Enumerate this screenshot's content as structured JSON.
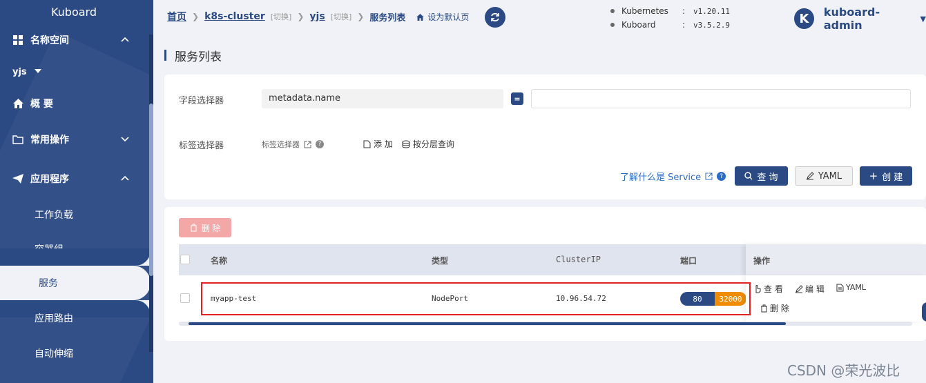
{
  "sidebar": {
    "brand": "Kuboard",
    "namespace_label": "名称空间",
    "namespace_value": "yjs",
    "overview": "概 要",
    "common_ops": "常用操作",
    "applications": "应用程序",
    "sub_items": [
      "工作负载",
      "容器组",
      "服务",
      "应用路由",
      "自动伸缩"
    ]
  },
  "header": {
    "home": "首页",
    "cluster": "k8s-cluster",
    "cluster_switch": "[切换]",
    "namespace": "yjs",
    "namespace_switch": "[切换]",
    "current": "服务列表",
    "set_default": "设为默认页",
    "versions": [
      {
        "name": "Kubernetes",
        "value": "v1.20.11"
      },
      {
        "name": "Kuboard",
        "value": "v3.5.2.9"
      }
    ],
    "user_initial": "K",
    "user_name": "kuboard-admin"
  },
  "page_title": "服务列表",
  "filter": {
    "field_selector_label": "字段选择器",
    "field_name": "metadata.name",
    "eq_symbol": "=",
    "field_value": "",
    "label_selector_label": "标签选择器",
    "label_selector_link": "标签选择器",
    "add": "添 加",
    "layered_query": "按分层查询",
    "learn_service": "了解什么是 Service",
    "query_btn": "查 询",
    "yaml_btn": "YAML",
    "create_btn": "创 建"
  },
  "table": {
    "delete_btn": "删 除",
    "columns": [
      "名称",
      "类型",
      "ClusterIP",
      "端口",
      "操作"
    ],
    "rows": [
      {
        "name": "myapp-test",
        "type": "NodePort",
        "cluster_ip": "10.96.54.72",
        "port": "80",
        "node_port": "32000",
        "ops": {
          "view": "查 看",
          "edit": "编 辑",
          "yaml": "YAML",
          "delete": "删 除"
        }
      }
    ]
  },
  "watermark": "CSDN @荣光波比",
  "colors": {
    "primary": "#2b4a84",
    "node_port": "#f08c00",
    "danger_light": "#f4a7a7",
    "highlight": "#e52020",
    "link": "#2b6cc4"
  }
}
